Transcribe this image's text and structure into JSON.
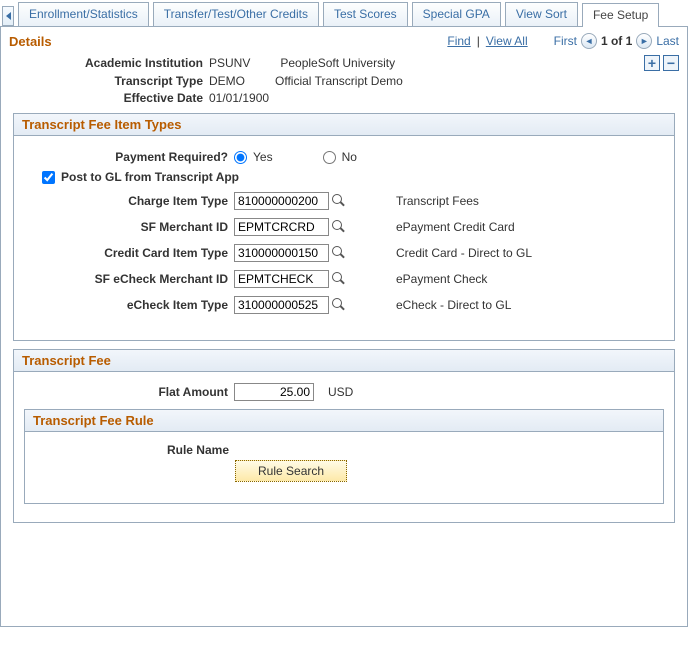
{
  "tabs": {
    "t0": "Enrollment/Statistics",
    "t1": "Transfer/Test/Other Credits",
    "t2": "Test Scores",
    "t3": "Special GPA",
    "t4": "View Sort",
    "t5": "Fee Setup"
  },
  "topbar": {
    "details": "Details",
    "find": "Find",
    "view_all": "View All",
    "first": "First",
    "pos": "1 of 1",
    "last": "Last"
  },
  "header": {
    "academic_institution_label": "Academic Institution",
    "academic_institution_code": "PSUNV",
    "academic_institution_desc": "PeopleSoft University",
    "transcript_type_label": "Transcript Type",
    "transcript_type_code": "DEMO",
    "transcript_type_desc": "Official Transcript Demo",
    "effective_date_label": "Effective Date",
    "effective_date_value": "01/01/1900"
  },
  "fee_item_types": {
    "title": "Transcript Fee Item Types",
    "payment_required_label": "Payment Required?",
    "yes": "Yes",
    "no": "No",
    "post_gl_label": "Post to GL from Transcript App",
    "fields": {
      "charge_item_type": {
        "label": "Charge Item Type",
        "value": "810000000200",
        "desc": "Transcript Fees"
      },
      "sf_merchant_id": {
        "label": "SF Merchant ID",
        "value": "EPMTCRCRD",
        "desc": "ePayment Credit Card"
      },
      "credit_card_item_type": {
        "label": "Credit Card Item Type",
        "value": "310000000150",
        "desc": "Credit Card - Direct to GL"
      },
      "sf_echeck_merchant_id": {
        "label": "SF eCheck Merchant ID",
        "value": "EPMTCHECK",
        "desc": "ePayment Check"
      },
      "echeck_item_type": {
        "label": "eCheck Item Type",
        "value": "310000000525",
        "desc": "eCheck - Direct to GL"
      }
    }
  },
  "transcript_fee": {
    "title": "Transcript Fee",
    "flat_amount_label": "Flat Amount",
    "flat_amount_value": "25.00",
    "currency": "USD"
  },
  "rule": {
    "title": "Transcript Fee Rule",
    "rule_name_label": "Rule Name",
    "rule_search_btn": "Rule Search"
  }
}
